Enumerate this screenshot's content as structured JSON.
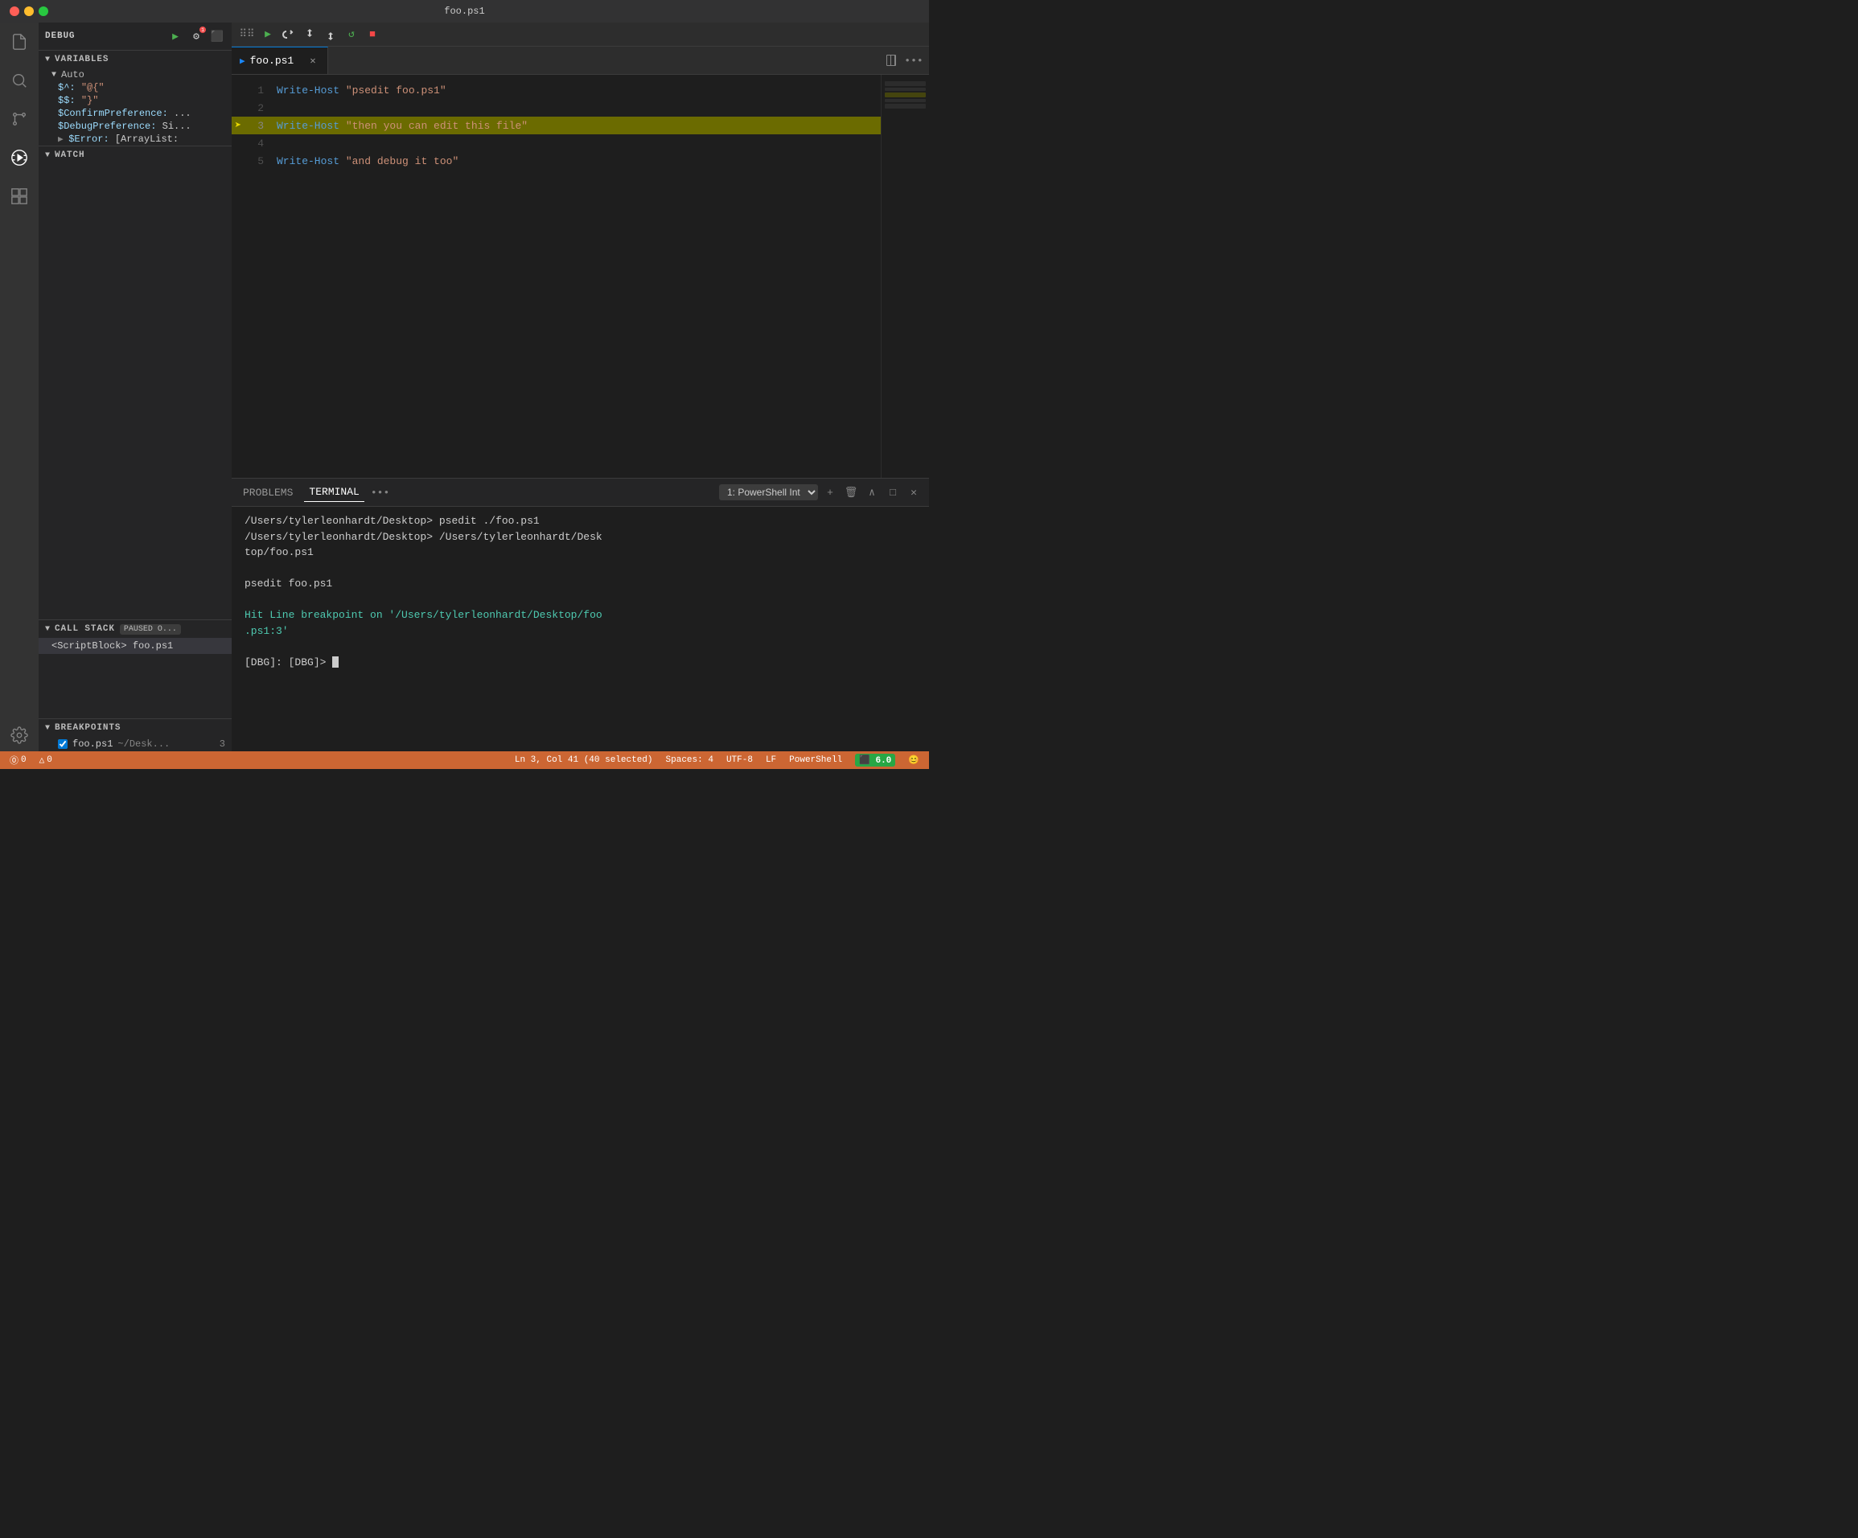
{
  "titlebar": {
    "title": "foo.ps1"
  },
  "activity_bar": {
    "icons": [
      {
        "name": "files-icon",
        "symbol": "📄",
        "active": false
      },
      {
        "name": "search-icon",
        "symbol": "🔍",
        "active": false
      },
      {
        "name": "source-control-icon",
        "symbol": "⑂",
        "active": false
      },
      {
        "name": "debug-icon",
        "symbol": "⊘",
        "active": true
      },
      {
        "name": "extensions-icon",
        "symbol": "⊞",
        "active": false
      }
    ],
    "bottom": [
      {
        "name": "settings-icon",
        "symbol": "⚙"
      }
    ]
  },
  "sidebar": {
    "debug_label": "DEBUG",
    "variables_label": "VARIABLES",
    "auto_label": "Auto",
    "vars": [
      {
        "key": "$^:",
        "val": "\"@{\""
      },
      {
        "key": "$$:",
        "val": "\"}\""
      },
      {
        "key": "$ConfirmPreference:",
        "val": "..."
      },
      {
        "key": "$DebugPreference:",
        "val": "Si..."
      },
      {
        "key": "$Error:",
        "val": "[ArrayList:"
      }
    ],
    "watch_label": "WATCH",
    "callstack_label": "CALL STACK",
    "callstack_badge": "PAUSED O...",
    "callstack_item": "<ScriptBlock>  foo.ps1",
    "breakpoints_label": "BREAKPOINTS",
    "breakpoints": [
      {
        "checked": true,
        "name": "foo.ps1",
        "path": "~/Desk...",
        "line": "3"
      }
    ]
  },
  "toolbar": {
    "drag_icon": "⋮⋮",
    "play_label": "▶",
    "restart_label": "↺",
    "step_over_label": "↷",
    "step_into_label": "↓",
    "step_out_label": "↑",
    "stop_label": "■"
  },
  "tab": {
    "icon": "▶",
    "name": "foo.ps1",
    "close": "✕"
  },
  "code": {
    "lines": [
      {
        "num": "1",
        "content": "Write-Host \"psedit foo.ps1\"",
        "highlighted": false,
        "breakpoint": false
      },
      {
        "num": "2",
        "content": "",
        "highlighted": false,
        "breakpoint": false
      },
      {
        "num": "3",
        "content": "Write-Host \"then you can edit this file\"",
        "highlighted": true,
        "breakpoint": true
      },
      {
        "num": "4",
        "content": "",
        "highlighted": false,
        "breakpoint": false
      },
      {
        "num": "5",
        "content": "Write-Host \"and debug it too\"",
        "highlighted": false,
        "breakpoint": false
      }
    ]
  },
  "terminal": {
    "tabs": [
      {
        "label": "PROBLEMS",
        "active": false
      },
      {
        "label": "TERMINAL",
        "active": true
      }
    ],
    "more_label": "•••",
    "dropdown_option": "1: PowerShell Int",
    "lines": [
      "/Users/tylerleonhardt/Desktop> psedit ./foo.ps1",
      "/Users/tylerleonhardt/Desktop> /Users/tylerleonhardt/Desktop/foo.ps1",
      "",
      "psedit foo.ps1",
      "",
      "Hit Line breakpoint on '/Users/tylerleonhardt/Desktop/foo.ps1:3'",
      "",
      "[DBG]:  [DBG]> "
    ]
  },
  "status_bar": {
    "error_count": "⓪ 0",
    "warning_count": "△ 0",
    "position": "Ln 3, Col 41 (40 selected)",
    "spaces": "Spaces: 4",
    "encoding": "UTF-8",
    "eol": "LF",
    "language": "PowerShell",
    "ps_version": "6.0",
    "emoji": "😊"
  }
}
